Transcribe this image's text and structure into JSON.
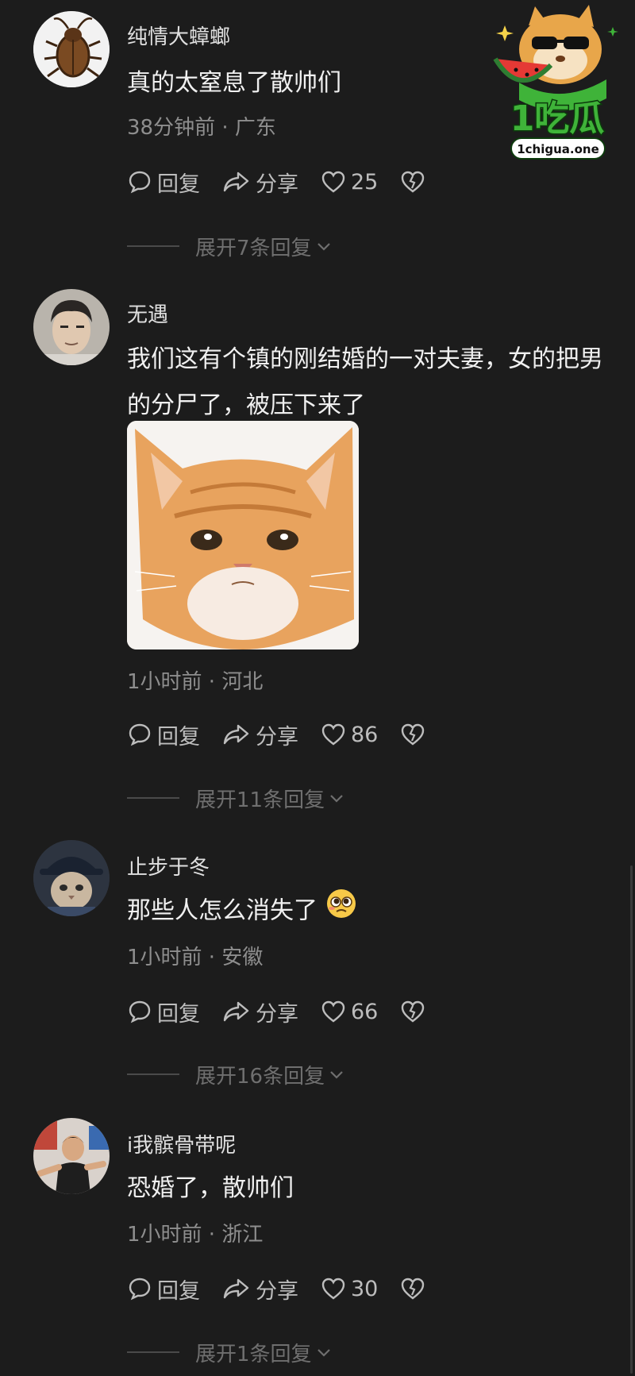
{
  "watermark": {
    "brand_text": "1吃瓜",
    "domain_text": "1chigua.one"
  },
  "actions": {
    "reply_label": "回复",
    "share_label": "分享"
  },
  "comments": [
    {
      "username": "纯情大蟑螂",
      "text": "真的太窒息了散帅们",
      "time": "38分钟前",
      "location": "广东",
      "likes": "25",
      "expand_label": "展开7条回复",
      "avatar": "cockroach-avatar"
    },
    {
      "username": "无遇",
      "text": "我们这有个镇的刚结婚的一对夫妻，女的把男的分尸了，被压下来了",
      "image": "sad-cat-meme",
      "time": "1小时前",
      "location": "河北",
      "likes": "86",
      "expand_label": "展开11条回复",
      "avatar": "man-portrait-avatar"
    },
    {
      "username": "止步于冬",
      "text": "那些人怎么消失了",
      "emoji": "pleading-face-emoji",
      "time": "1小时前",
      "location": "安徽",
      "likes": "66",
      "expand_label": "展开16条回复",
      "avatar": "cat-in-hat-avatar"
    },
    {
      "username": "i我髌骨带呢",
      "text": "恐婚了，散帅们",
      "time": "1小时前",
      "location": "浙江",
      "likes": "30",
      "expand_label": "展开1条回复",
      "avatar": "boy-photo-avatar"
    }
  ],
  "meta_separator": " · ",
  "colors": {
    "background": "#1c1c1c",
    "text": "#f0f0f0",
    "meta": "#8e8e8e",
    "logo_green": "#3fb339"
  }
}
